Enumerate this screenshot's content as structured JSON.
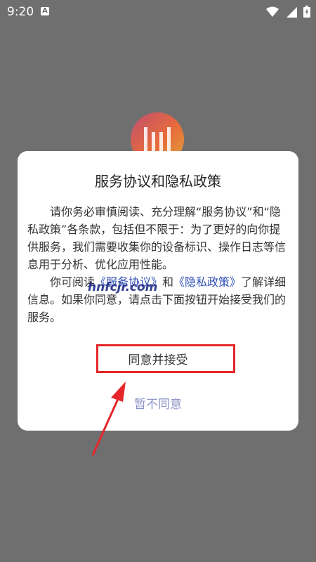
{
  "status_bar": {
    "time": "9:20",
    "indicator": "A",
    "icons": [
      "wifi-icon",
      "signal-icon",
      "battery-icon"
    ]
  },
  "app": {
    "logo": "app-logo"
  },
  "dialog": {
    "title": "服务协议和隐私政策",
    "paragraph1": "请你务必审慎阅读、充分理解“服务协议”和“隐私政策”各条款，包括但不限于：为了更好的向你提供服务，我们需要收集你的设备标识、操作日志等信息用于分析、优化应用性能。",
    "paragraph2_prefix": "你可阅读",
    "link_service": "《服务协议》",
    "paragraph2_and": "和",
    "link_privacy": "《隐私政策》",
    "paragraph2_suffix": "了解详细信息。如果你同意，请点击下面按钮开始接受我们的服务。",
    "agree_label": "同意并接受",
    "disagree_label": "暂不同意"
  },
  "watermark": "hnfcjr.com",
  "colors": {
    "overlay": "#6f6f6f",
    "link": "#2f4fb6",
    "disagree": "#8b93c8",
    "annotation_red": "#e6262a"
  }
}
